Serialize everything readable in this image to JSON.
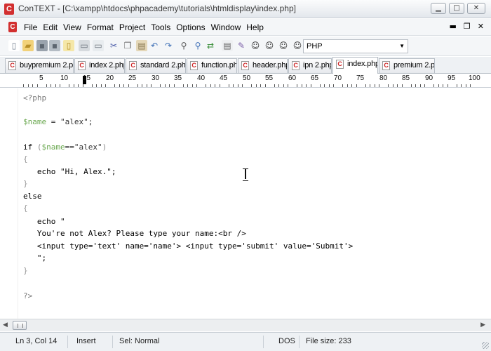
{
  "window": {
    "title": "ConTEXT - [C:\\xampp\\htdocs\\phpacademy\\tutorials\\htmldisplay\\index.php]",
    "app_icon": "C",
    "minimize": "▁",
    "maximize": "□",
    "close": "✕"
  },
  "menu": {
    "items": [
      "File",
      "Edit",
      "View",
      "Format",
      "Project",
      "Tools",
      "Options",
      "Window",
      "Help"
    ],
    "doc_minimize": "▬",
    "doc_restore": "❐",
    "doc_close": "✕"
  },
  "toolbar": {
    "language": "PHP",
    "dropdown_arrow": "▼",
    "icons": [
      "new-file-icon",
      "open-folder-icon",
      "save-icon",
      "save-all-icon",
      "close-file-icon",
      "print-icon",
      "print-preview-icon",
      "cut-icon",
      "copy-icon",
      "paste-icon",
      "undo-icon",
      "redo-icon",
      "find-icon",
      "find-next-icon",
      "replace-icon",
      "export-icon",
      "highlighter-icon",
      "user-exec-1-icon",
      "user-exec-2-icon",
      "user-exec-3-icon",
      "user-exec-4-icon"
    ]
  },
  "tabs": [
    "buypremium 2.php",
    "index 2.php",
    "standard 2.php",
    "function.php",
    "header.php",
    "ipn 2.php",
    "index.php",
    "premium 2.php"
  ],
  "active_tab": "index.php",
  "ruler": {
    "labels": [
      "5",
      "10",
      "15",
      "20",
      "25",
      "30",
      "35",
      "40",
      "45",
      "50",
      "55",
      "60",
      "65",
      "70",
      "75",
      "80",
      "85",
      "90",
      "95",
      "100"
    ]
  },
  "code": {
    "l1": "<?php",
    "l2_var": "$name",
    "l2_rest": " = \"alex\";",
    "l3_kw": "if ",
    "l3_open": "(",
    "l3_var": "$name",
    "l3_rest": "==\"alex\"",
    "l3_close": ")",
    "brace_open": "{",
    "brace_close": "}",
    "l5": "   echo \"Hi, Alex.\";",
    "l7": "else",
    "l9": "   echo \"",
    "l10": "   You're not Alex? Please type your name:<br />",
    "l11": "   <input type='text' name='name'> <input type='submit' value='Submit'>",
    "l12": "   \";",
    "l14": "?>"
  },
  "status": {
    "position": "Ln 3, Col 14",
    "mode": "Insert",
    "selection": "Sel: Normal",
    "line_ending": "DOS",
    "file_size": "File size: 233"
  },
  "scrollbar": {
    "left_arrow": "◀",
    "right_arrow": "▶"
  }
}
